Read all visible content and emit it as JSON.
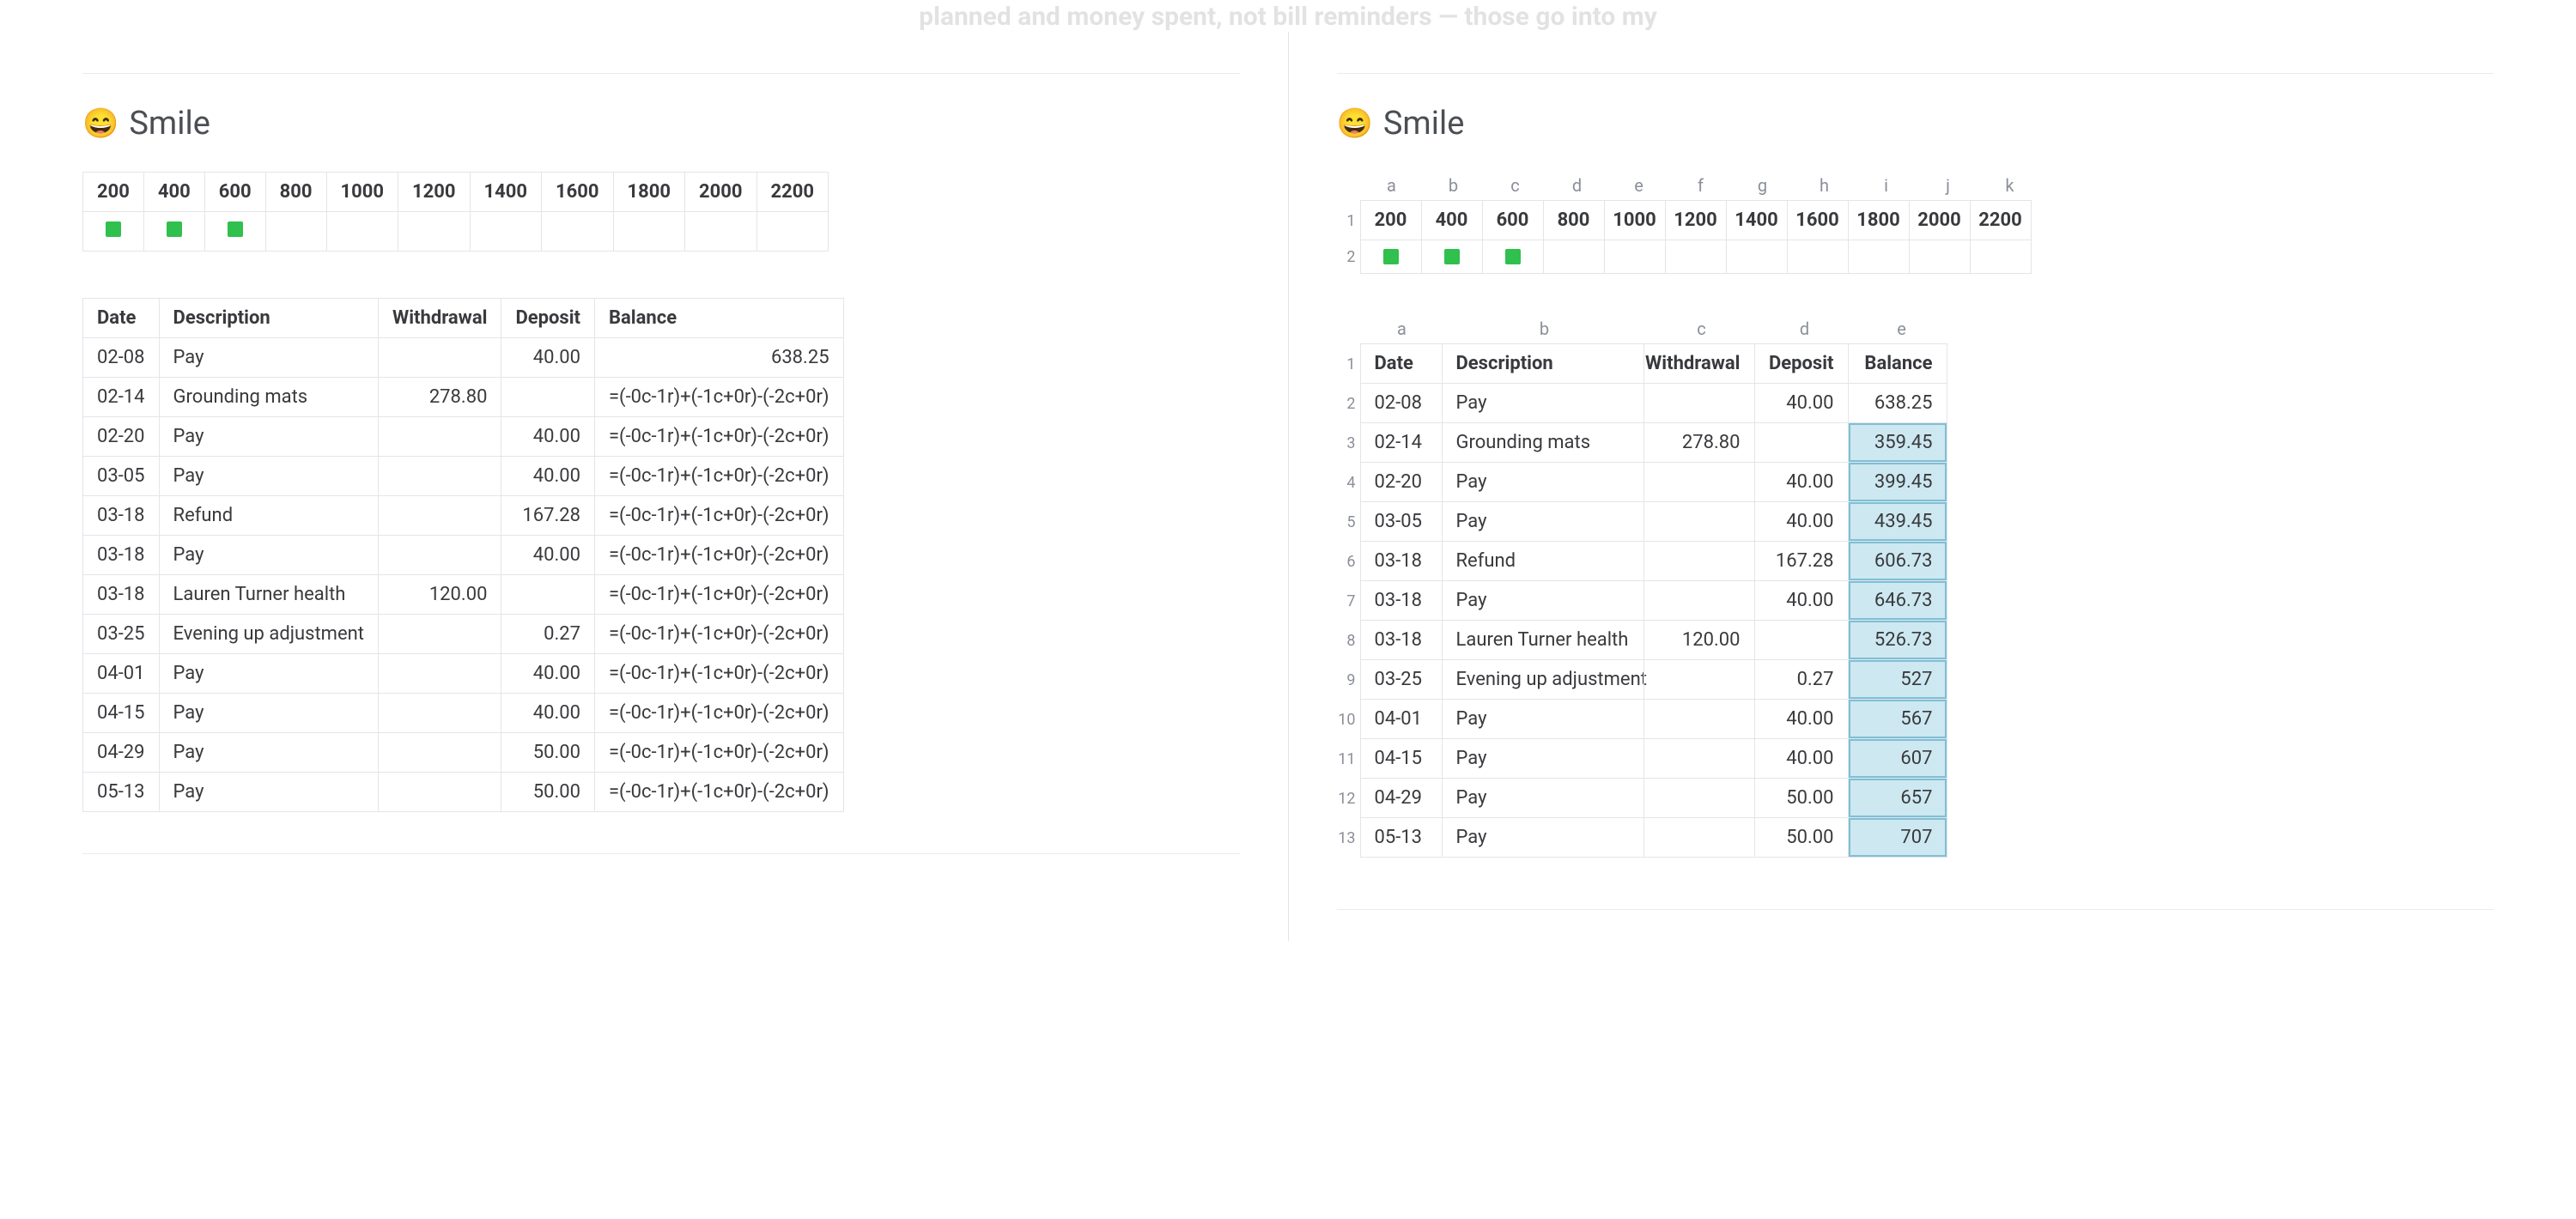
{
  "top_faded_text": "planned and money spent, not bill reminders — those go into my",
  "heading": {
    "emoji": "😄",
    "title": "Smile"
  },
  "left": {
    "top_table": {
      "headers": [
        "200",
        "400",
        "600",
        "800",
        "1000",
        "1200",
        "1400",
        "1600",
        "1800",
        "2000",
        "2200"
      ],
      "squares_row_filled": [
        true,
        true,
        true,
        false,
        false,
        false,
        false,
        false,
        false,
        false,
        false
      ]
    },
    "ledger": {
      "columns": [
        "Date",
        "Description",
        "Withdrawal",
        "Deposit",
        "Balance"
      ],
      "rows": [
        {
          "date": "02-08",
          "desc": "Pay",
          "withdrawal": "",
          "deposit": "40.00",
          "balance": "638.25"
        },
        {
          "date": "02-14",
          "desc": "Grounding mats",
          "withdrawal": "278.80",
          "deposit": "",
          "balance": "=(-0c-1r)+(-1c+0r)-(-2c+0r)"
        },
        {
          "date": "02-20",
          "desc": "Pay",
          "withdrawal": "",
          "deposit": "40.00",
          "balance": "=(-0c-1r)+(-1c+0r)-(-2c+0r)"
        },
        {
          "date": "03-05",
          "desc": "Pay",
          "withdrawal": "",
          "deposit": "40.00",
          "balance": "=(-0c-1r)+(-1c+0r)-(-2c+0r)"
        },
        {
          "date": "03-18",
          "desc": "Refund",
          "withdrawal": "",
          "deposit": "167.28",
          "balance": "=(-0c-1r)+(-1c+0r)-(-2c+0r)"
        },
        {
          "date": "03-18",
          "desc": "Pay",
          "withdrawal": "",
          "deposit": "40.00",
          "balance": "=(-0c-1r)+(-1c+0r)-(-2c+0r)"
        },
        {
          "date": "03-18",
          "desc": "Lauren Turner health",
          "withdrawal": "120.00",
          "deposit": "",
          "balance": "=(-0c-1r)+(-1c+0r)-(-2c+0r)"
        },
        {
          "date": "03-25",
          "desc": "Evening up adjustment",
          "withdrawal": "",
          "deposit": "0.27",
          "balance": "=(-0c-1r)+(-1c+0r)-(-2c+0r)"
        },
        {
          "date": "04-01",
          "desc": "Pay",
          "withdrawal": "",
          "deposit": "40.00",
          "balance": "=(-0c-1r)+(-1c+0r)-(-2c+0r)"
        },
        {
          "date": "04-15",
          "desc": "Pay",
          "withdrawal": "",
          "deposit": "40.00",
          "balance": "=(-0c-1r)+(-1c+0r)-(-2c+0r)"
        },
        {
          "date": "04-29",
          "desc": "Pay",
          "withdrawal": "",
          "deposit": "50.00",
          "balance": "=(-0c-1r)+(-1c+0r)-(-2c+0r)"
        },
        {
          "date": "05-13",
          "desc": "Pay",
          "withdrawal": "",
          "deposit": "50.00",
          "balance": "=(-0c-1r)+(-1c+0r)-(-2c+0r)"
        }
      ]
    }
  },
  "right": {
    "top_sheet": {
      "col_letters": [
        "a",
        "b",
        "c",
        "d",
        "e",
        "f",
        "g",
        "h",
        "i",
        "j",
        "k"
      ],
      "headers": [
        "200",
        "400",
        "600",
        "800",
        "1000",
        "1200",
        "1400",
        "1600",
        "1800",
        "2000",
        "2200"
      ],
      "squares_row_filled": [
        true,
        true,
        true,
        false,
        false,
        false,
        false,
        false,
        false,
        false,
        false
      ]
    },
    "ledger_sheet": {
      "col_letters": [
        "a",
        "b",
        "c",
        "d",
        "e"
      ],
      "columns": [
        "Date",
        "Description",
        "Withdrawal",
        "Deposit",
        "Balance"
      ],
      "rows": [
        {
          "date": "02-08",
          "desc": "Pay",
          "withdrawal": "",
          "deposit": "40.00",
          "balance": "638.25",
          "hi": false
        },
        {
          "date": "02-14",
          "desc": "Grounding mats",
          "withdrawal": "278.80",
          "deposit": "",
          "balance": "359.45",
          "hi": true
        },
        {
          "date": "02-20",
          "desc": "Pay",
          "withdrawal": "",
          "deposit": "40.00",
          "balance": "399.45",
          "hi": true
        },
        {
          "date": "03-05",
          "desc": "Pay",
          "withdrawal": "",
          "deposit": "40.00",
          "balance": "439.45",
          "hi": true
        },
        {
          "date": "03-18",
          "desc": "Refund",
          "withdrawal": "",
          "deposit": "167.28",
          "balance": "606.73",
          "hi": true
        },
        {
          "date": "03-18",
          "desc": "Pay",
          "withdrawal": "",
          "deposit": "40.00",
          "balance": "646.73",
          "hi": true
        },
        {
          "date": "03-18",
          "desc": "Lauren Turner health",
          "withdrawal": "120.00",
          "deposit": "",
          "balance": "526.73",
          "hi": true
        },
        {
          "date": "03-25",
          "desc": "Evening up adjustment",
          "withdrawal": "",
          "deposit": "0.27",
          "balance": "527",
          "hi": true
        },
        {
          "date": "04-01",
          "desc": "Pay",
          "withdrawal": "",
          "deposit": "40.00",
          "balance": "567",
          "hi": true
        },
        {
          "date": "04-15",
          "desc": "Pay",
          "withdrawal": "",
          "deposit": "40.00",
          "balance": "607",
          "hi": true
        },
        {
          "date": "04-29",
          "desc": "Pay",
          "withdrawal": "",
          "deposit": "50.00",
          "balance": "657",
          "hi": true
        },
        {
          "date": "05-13",
          "desc": "Pay",
          "withdrawal": "",
          "deposit": "50.00",
          "balance": "707",
          "hi": true
        }
      ]
    }
  }
}
